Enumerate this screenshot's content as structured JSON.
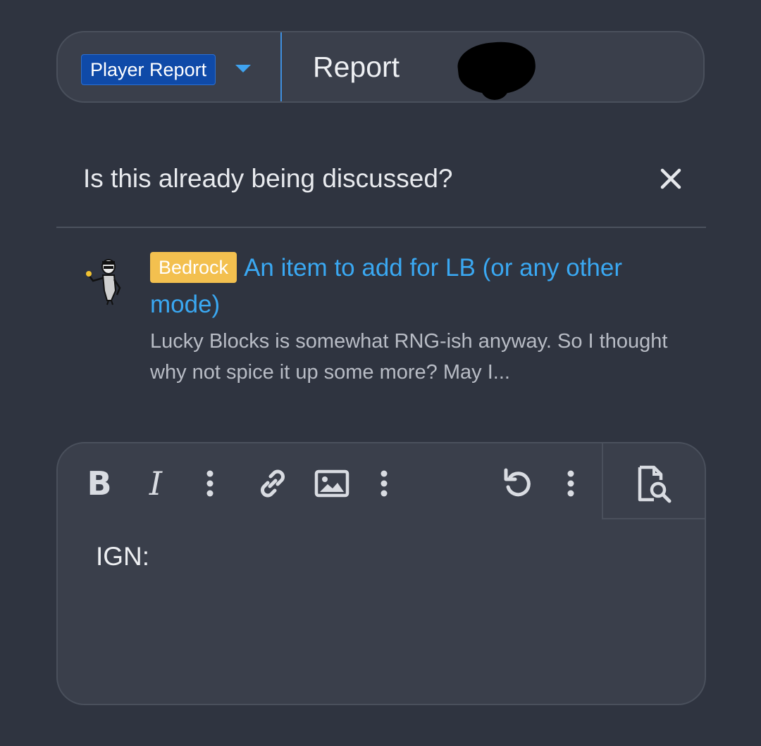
{
  "title_bar": {
    "prefix_label": "Player Report",
    "title_value": "Report"
  },
  "similar_threads": {
    "heading": "Is this already being discussed?",
    "items": [
      {
        "badge": "Bedrock",
        "title": "An item to add for LB (or any other mode)",
        "snippet": "Lucky Blocks is somewhat RNG-ish anyway. So I thought why not spice it up some more? May I..."
      }
    ]
  },
  "editor": {
    "toolbar": {
      "bold_label": "B",
      "italic_label": "I",
      "icons": [
        "more-options-icon",
        "link-icon",
        "image-icon",
        "more-options-icon",
        "undo-icon",
        "more-options-icon",
        "preview-icon"
      ]
    },
    "content": "IGN:"
  },
  "colors": {
    "background": "#2f3440",
    "panel": "#3a3f4b",
    "accent_blue": "#3aa8f2",
    "prefix_blue": "#0f4aa8",
    "badge_yellow": "#f3c04f"
  }
}
